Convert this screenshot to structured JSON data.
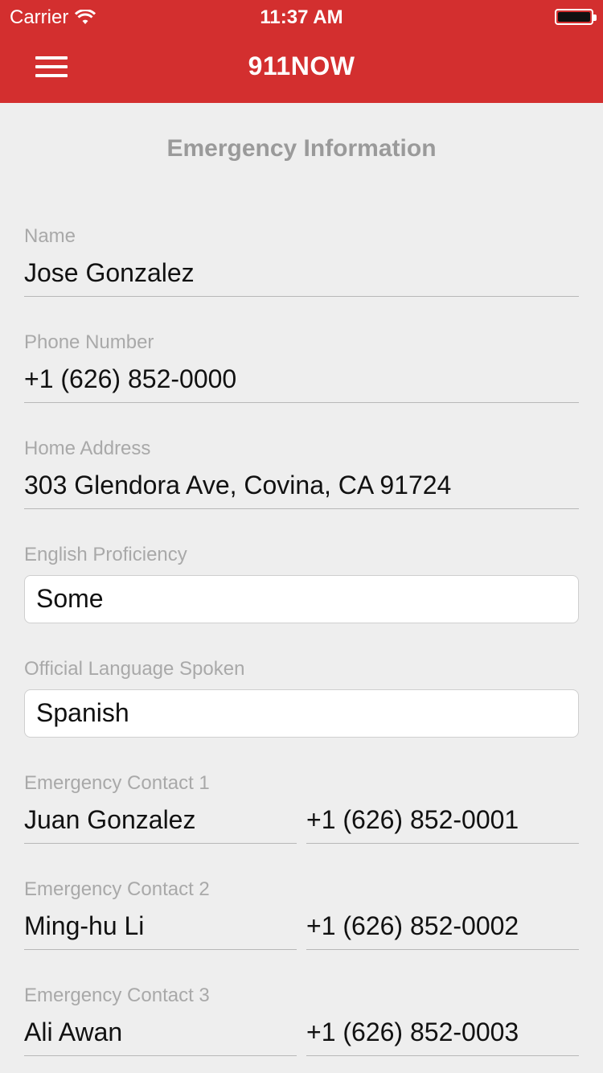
{
  "status_bar": {
    "carrier": "Carrier",
    "time": "11:37 AM"
  },
  "header": {
    "title": "911NOW",
    "menu_icon": "hamburger-icon",
    "color": "#d32f2f"
  },
  "section_title": "Emergency Information",
  "form": {
    "name": {
      "label": "Name",
      "value": "Jose Gonzalez"
    },
    "phone": {
      "label": "Phone Number",
      "value": "+1 (626) 852-0000"
    },
    "address": {
      "label": "Home Address",
      "value": "303 Glendora Ave, Covina, CA 91724"
    },
    "english": {
      "label": "English Proficiency",
      "value": "Some"
    },
    "language": {
      "label": "Official Language Spoken",
      "value": "Spanish"
    },
    "contacts": [
      {
        "label": "Emergency Contact 1",
        "name": "Juan Gonzalez",
        "phone": "+1 (626) 852-0001"
      },
      {
        "label": "Emergency Contact 2",
        "name": "Ming-hu Li",
        "phone": "+1 (626) 852-0002"
      },
      {
        "label": "Emergency Contact 3",
        "name": "Ali Awan",
        "phone": "+1 (626) 852-0003"
      }
    ]
  }
}
